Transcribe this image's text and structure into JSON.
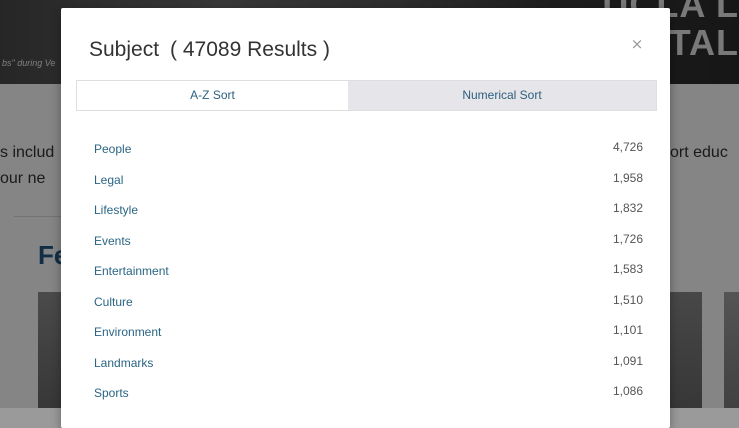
{
  "background": {
    "hero_caption": "bs\" during Ve",
    "brand_line_1": "UCLA L",
    "brand_line_2": "ITAL",
    "text_left_line_1": "s includ",
    "text_left_line_2": "our ne",
    "text_right_line_1": "ort educ",
    "heading": "Fe"
  },
  "modal": {
    "title": "Subject",
    "result_count": "( 47089 Results )",
    "close_label": "×",
    "tabs": [
      {
        "label": "A-Z Sort",
        "active": true
      },
      {
        "label": "Numerical Sort",
        "active": false
      }
    ],
    "results": [
      {
        "label": "People",
        "count": "4,726"
      },
      {
        "label": "Legal",
        "count": "1,958"
      },
      {
        "label": "Lifestyle",
        "count": "1,832"
      },
      {
        "label": "Events",
        "count": "1,726"
      },
      {
        "label": "Entertainment",
        "count": "1,583"
      },
      {
        "label": "Culture",
        "count": "1,510"
      },
      {
        "label": "Environment",
        "count": "1,101"
      },
      {
        "label": "Landmarks",
        "count": "1,091"
      },
      {
        "label": "Sports",
        "count": "1,086"
      }
    ]
  },
  "colors": {
    "link": "#2a6584",
    "heading_bg": "#1f5b86",
    "tab_inactive_bg": "#e6e5e9"
  }
}
